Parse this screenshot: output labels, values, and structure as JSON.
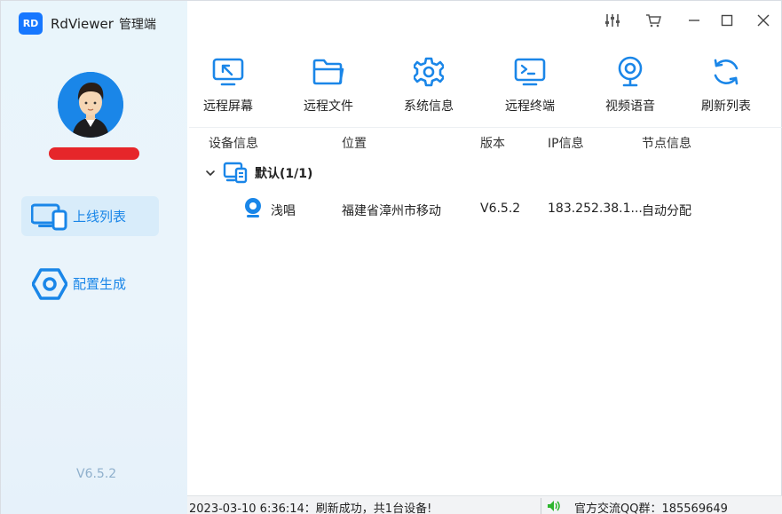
{
  "app": {
    "logo_text": "RD",
    "title": "RdViewer",
    "subtitle": "管理端",
    "version": "V6.5.2",
    "brand_color": "#1677ff",
    "accent_color": "#1a86e8"
  },
  "window_controls": [
    {
      "name": "settings-sliders-icon"
    },
    {
      "name": "cart-icon"
    },
    {
      "name": "minimize-icon"
    },
    {
      "name": "maximize-icon"
    },
    {
      "name": "close-icon"
    }
  ],
  "sidebar": {
    "items": [
      {
        "label": "上线列表",
        "icon": "devices-icon",
        "active": true
      },
      {
        "label": "配置生成",
        "icon": "hexagon-settings-icon",
        "active": false
      }
    ]
  },
  "toolbar": {
    "items": [
      {
        "label": "远程屏幕",
        "icon": "remote-screen-icon"
      },
      {
        "label": "远程文件",
        "icon": "folder-icon"
      },
      {
        "label": "系统信息",
        "icon": "gear-icon"
      },
      {
        "label": "远程终端",
        "icon": "terminal-icon"
      },
      {
        "label": "视频语音",
        "icon": "webcam-icon"
      },
      {
        "label": "刷新列表",
        "icon": "refresh-icon"
      }
    ]
  },
  "table": {
    "columns": [
      "设备信息",
      "位置",
      "版本",
      "IP信息",
      "节点信息"
    ],
    "group": {
      "label": "默认(1/1)",
      "expanded": true
    },
    "rows": [
      {
        "name": "浅唱",
        "location": "福建省漳州市移动",
        "version": "V6.5.2",
        "ip": "183.252.38.1...",
        "node": "自动分配"
      }
    ]
  },
  "status": {
    "message": "2023-03-10 6:36:14：刷新成功，共1台设备!",
    "qq_group": "官方交流QQ群：185569649",
    "speaker_color": "#2db52d"
  }
}
